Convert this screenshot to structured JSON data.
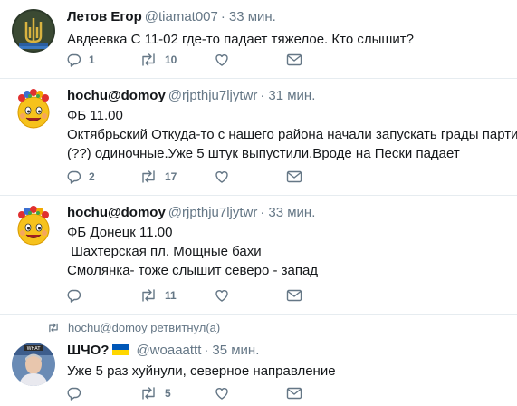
{
  "tweets": [
    {
      "name": "Летов Егор",
      "handle": "@tiamat007",
      "time": "33 мин.",
      "lines": [
        "Авдеевка С 11-02 где-то падает тяжелое. Кто слышит?"
      ],
      "replies": "1",
      "retweets": "10",
      "avatar_icon": "dark-avatar-trident-emblem"
    },
    {
      "name": "hochu@domoy",
      "handle": "@rjpthju7ljytwr",
      "time": "31 мин.",
      "lines": [
        "ФБ 11.00",
        "Октябрьский Откуда-то с нашего района начали запускать грады партизан",
        "(??) одиночные.Уже 5 штук выпустили.Вроде на Пески падает"
      ],
      "replies": "2",
      "retweets": "17",
      "avatar_icon": "smiley-flower-wreath-avatar"
    },
    {
      "name": "hochu@domoy",
      "handle": "@rjpthju7ljytwr",
      "time": "33 мин.",
      "lines": [
        "ФБ Донецк 11.00",
        " Шахтерская пл. Мощные бахи",
        "Смолянка- тоже слышит северо - запад"
      ],
      "replies": "",
      "retweets": "11",
      "avatar_icon": "smiley-flower-wreath-avatar"
    },
    {
      "retweet_context": "hochu@domoy ретвитнул(а)",
      "name": "ШЧО?",
      "handle": "@woaaattt",
      "time": "35 мин.",
      "lines": [
        "Уже 5 раз хуйнули, северное направление"
      ],
      "replies": "",
      "retweets": "5",
      "avatar_icon": "photo-avatar-man",
      "flag_colors": [
        "#0057b7",
        "#ffd700"
      ]
    }
  ]
}
